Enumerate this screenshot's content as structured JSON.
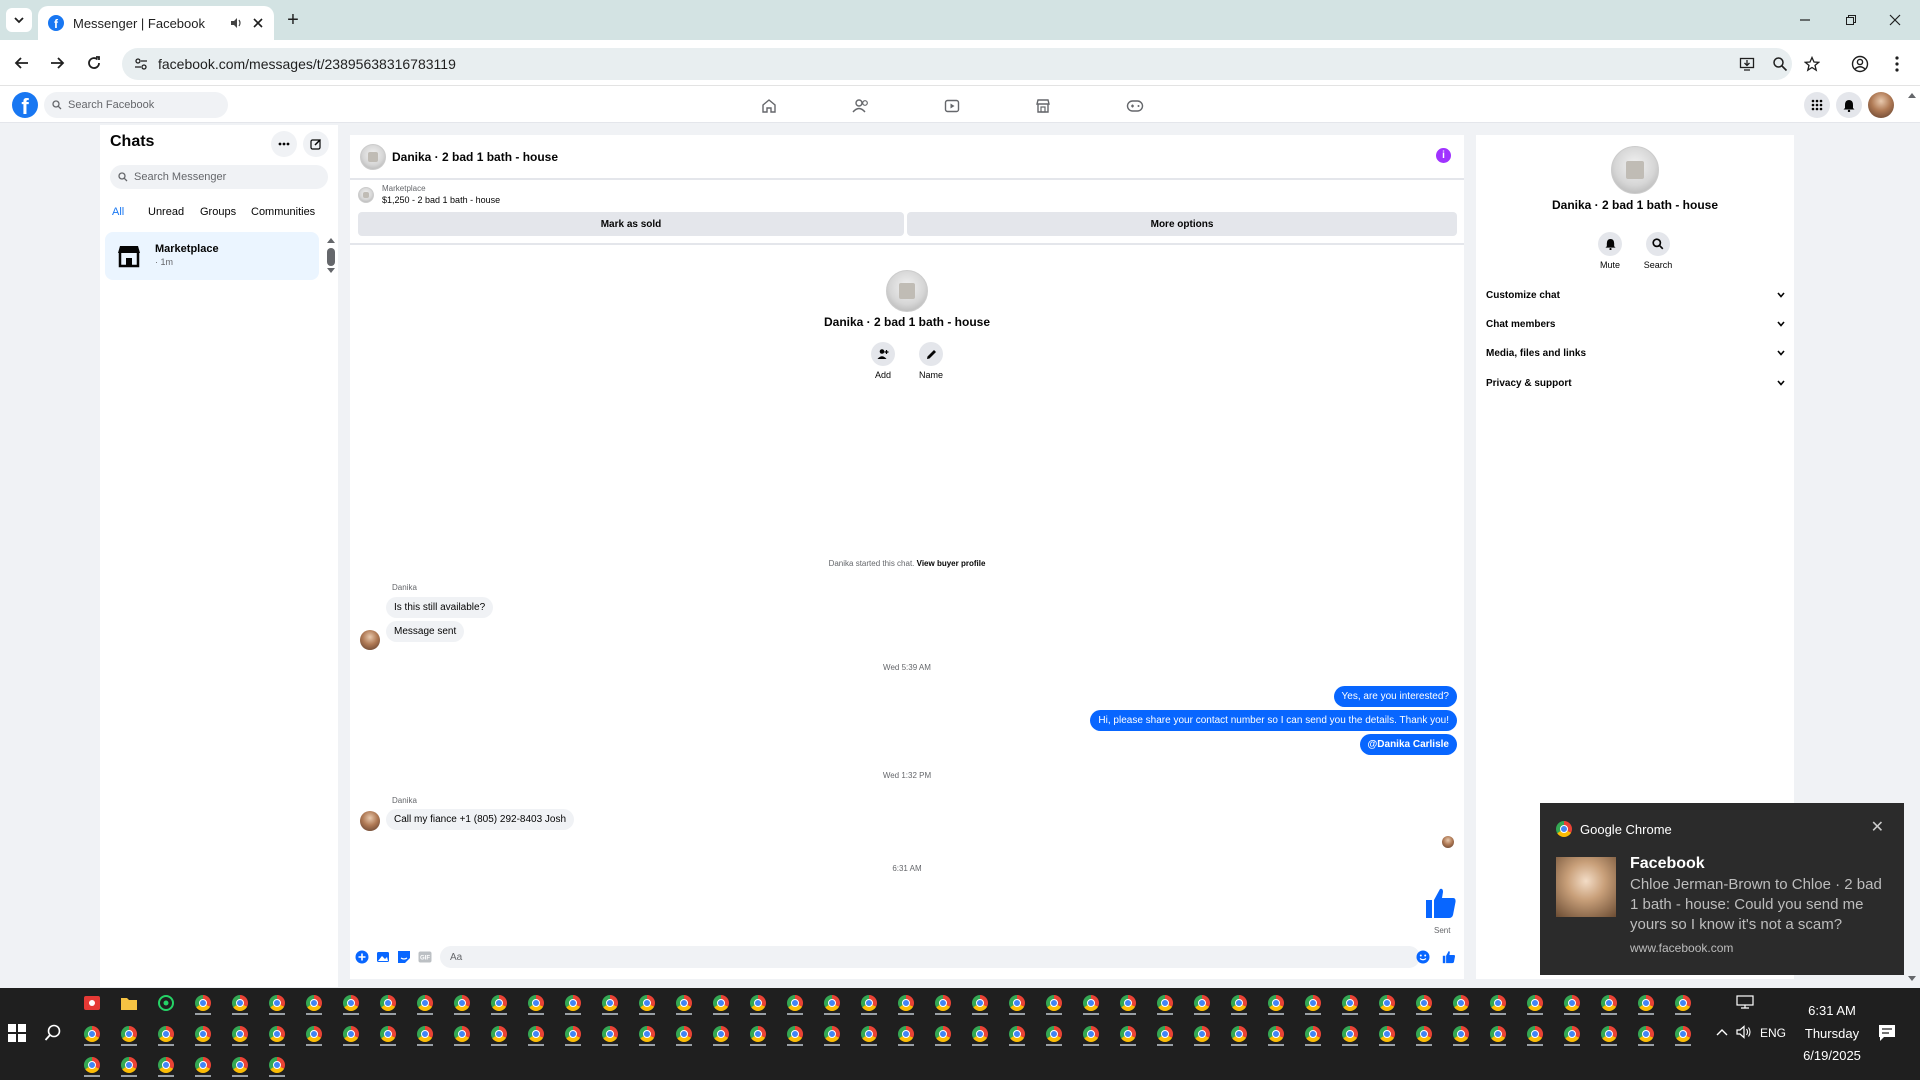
{
  "browser": {
    "tab_title": "Messenger | Facebook",
    "url": "facebook.com/messages/t/23895638316783119"
  },
  "facebook": {
    "search_placeholder": "Search Facebook"
  },
  "chats": {
    "title": "Chats",
    "search_placeholder": "Search Messenger",
    "filters": [
      "All",
      "Unread",
      "Groups",
      "Communities"
    ],
    "items": [
      {
        "name": "Marketplace",
        "time": "· 1m"
      }
    ]
  },
  "conversation": {
    "title": "Danika · 2 bad 1 bath - house",
    "marketplace_label": "Marketplace",
    "listing": "$1,250 - 2 bad 1 bath - house",
    "mark_sold": "Mark as sold",
    "more_options": "More options",
    "center_name": "Danika · 2 bad 1 bath - house",
    "add_label": "Add",
    "name_label": "Name",
    "started": "Danika started this chat.",
    "view_profile": "View buyer profile",
    "messages": [
      {
        "sender": "Danika",
        "text": "Is this still available?"
      },
      {
        "text": "Message sent"
      },
      {
        "time": "Wed 5:39 AM"
      },
      {
        "text": "Yes, are you interested?"
      },
      {
        "text": "Hi, please share your contact number so I can send you the details. Thank you!"
      },
      {
        "text": "@Danika Carlisle"
      },
      {
        "time": "Wed 1:32 PM"
      },
      {
        "sender": "Danika",
        "text": "Call my fiance +1 (805) 292-8403 Josh"
      },
      {
        "time": "6:31 AM"
      },
      {
        "status": "Sent"
      }
    ],
    "composer_placeholder": "Aa"
  },
  "info_panel": {
    "name": "Danika · 2 bad 1 bath - house",
    "mute": "Mute",
    "search": "Search",
    "sections": [
      "Customize chat",
      "Chat members",
      "Media, files and links",
      "Privacy & support"
    ]
  },
  "notification": {
    "app": "Google Chrome",
    "title": "Facebook",
    "body": "Chloe Jerman-Brown to Chloe · 2 bad 1 bath - house: Could you send me yours so I know it's not a scam?",
    "source": "www.facebook.com"
  },
  "taskbar": {
    "time": "6:31 AM",
    "day": "Thursday",
    "date": "6/19/2025",
    "language": "ENG"
  },
  "colors": {
    "facebook_blue": "#1877f2",
    "outgoing_bubble": "#0866ff",
    "tab_strip": "#d3e3e3"
  }
}
